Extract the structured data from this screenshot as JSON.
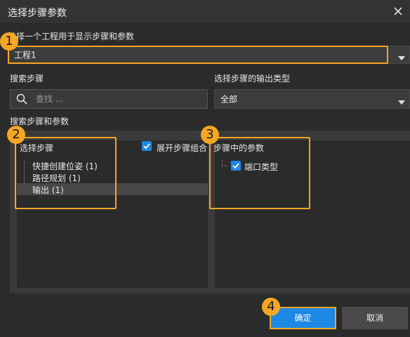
{
  "window": {
    "title": "选择步骤参数",
    "close_icon": "close-icon"
  },
  "project": {
    "label": "选择一个工程用于显示步骤和参数",
    "selected": "工程1"
  },
  "search": {
    "label": "搜索步骤",
    "placeholder": "查找 ..."
  },
  "output_type": {
    "label": "选择步骤的输出类型",
    "selected": "全部"
  },
  "steps_params_label": "搜索步骤和参数",
  "steps": {
    "header": "选择步骤",
    "expand_toggle": {
      "label": "展开步骤组合",
      "checked": true
    },
    "items": [
      {
        "label": "快捷创建位姿 (1)",
        "selected": false
      },
      {
        "label": "路径规划 (1)",
        "selected": false
      },
      {
        "label": "输出 (1)",
        "selected": true
      }
    ]
  },
  "params": {
    "header": "步骤中的参数",
    "items": [
      {
        "label": "端口类型",
        "checked": true
      }
    ]
  },
  "buttons": {
    "ok": "确定",
    "cancel": "取消"
  },
  "callouts": [
    "1",
    "2",
    "3",
    "4"
  ],
  "colors": {
    "accent": "#1e88e5",
    "highlight": "#f5a623",
    "background": "#2b2b2b"
  }
}
